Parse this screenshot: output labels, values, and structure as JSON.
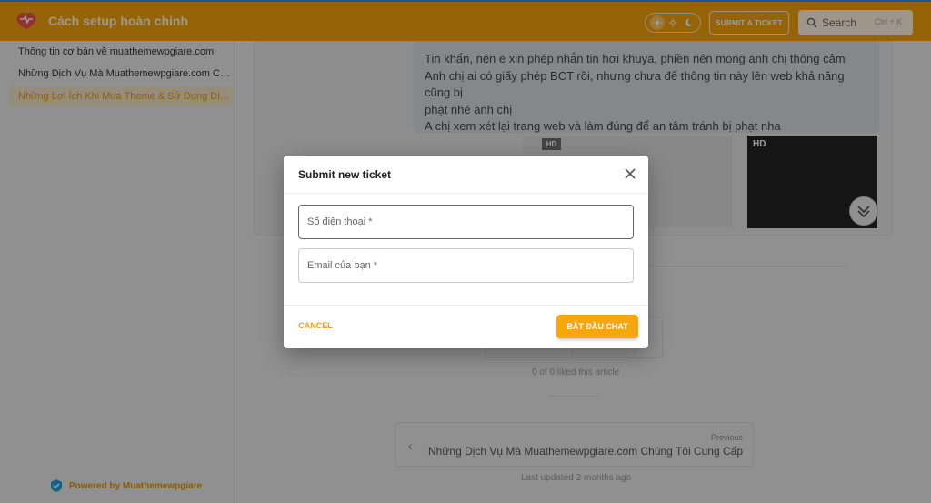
{
  "header": {
    "app_title": "Cách setup hoàn chỉnh",
    "submit_ticket_label": "SUBMIT A TICKET",
    "search_label": "Search",
    "search_shortcut": "Ctrl + K",
    "accent_color": "#f4a00c",
    "theme_options": [
      "sun-icon",
      "sun-dim-icon",
      "moon-icon"
    ]
  },
  "sidebar": {
    "items": [
      {
        "label": "Thông tin cơ bản về muathemewpgiare.com",
        "active": false
      },
      {
        "label": "Những Dịch Vụ Mà Muathemewpgiare.com Chúng Tôi Cung Cấp",
        "active": false
      },
      {
        "label": "Những Lợi Ích Khi Mua Theme & Sử Dụng Dịch Vụ",
        "active": true
      }
    ],
    "powered_by": "Powered by Muathemewpgiare"
  },
  "article": {
    "chat_lines": [
      "Tin khẩn, nên e xin phép nhắn tin hơi khuya, phiền nên mong anh chị thông cảm",
      "Anh chị ai có giấy phép BCT rồi, nhưng chưa để thông tin này lên web khả năng cũng bị",
      "phạt nhé anh chị",
      "A chị xem xét lại trang web và làm đúng để an tâm tránh bị phạt nha"
    ],
    "hd_badge": "HD",
    "liked_text": "0 of 0 liked this article",
    "previous_label": "Previous",
    "previous_title": "Những Dịch Vụ Mà Muathemewpgiare.com Chúng Tôi Cung Cấp",
    "last_updated": "Last updated 2 months ago"
  },
  "modal": {
    "title": "Submit new ticket",
    "phone_placeholder": "Số điện thoại *",
    "email_placeholder": "Email của bạn *",
    "cancel_label": "CANCEL",
    "start_label": "BẮT ĐẦU CHAT",
    "button_color": "#f7a70e"
  }
}
